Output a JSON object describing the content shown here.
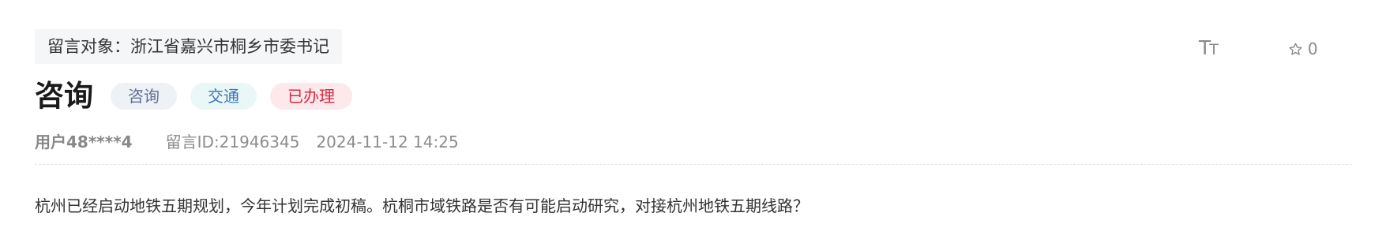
{
  "message": {
    "recipient": "留言对象：浙江省嘉兴市桐乡市委书记",
    "title": "咨询",
    "tags": {
      "type": "咨询",
      "category": "交通",
      "status": "已办理"
    },
    "author": "用户48****4",
    "message_id": "留言ID:21946345",
    "datetime": "2024-11-12 14:25",
    "content": "杭州已经启动地铁五期规划，今年计划完成初稿。杭桐市域铁路是否有可能启动研究，对接杭州地铁五期线路？"
  },
  "toolbar": {
    "font_size_icon": "font-size-icon",
    "font_size_glyph_large": "T",
    "font_size_glyph_small": "T",
    "favorite_icon": "star-icon",
    "favorite_count": "0"
  },
  "colors": {
    "tag_type_bg": "#eef1f6",
    "tag_type_text": "#607090",
    "tag_category_bg": "#eaf7f7",
    "tag_category_text": "#3a77b8",
    "tag_status_bg": "#fde9ec",
    "tag_status_text": "#d8283f"
  }
}
